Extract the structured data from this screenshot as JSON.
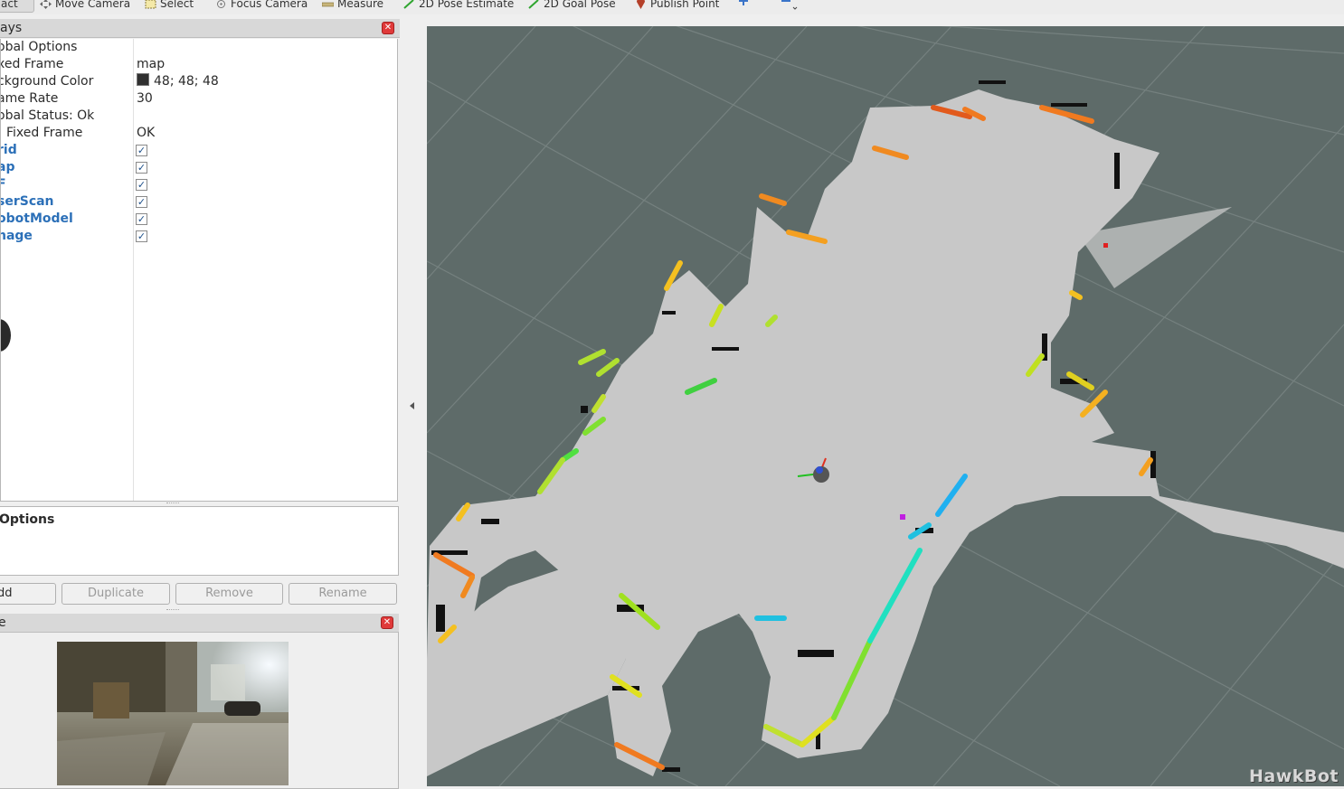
{
  "toolbar": {
    "items": [
      {
        "label": "act",
        "icon": "interact-icon"
      },
      {
        "label": "Move Camera",
        "icon": "move-camera-icon"
      },
      {
        "label": "Select",
        "icon": "select-icon"
      },
      {
        "label": "Focus Camera",
        "icon": "focus-camera-icon"
      },
      {
        "label": "Measure",
        "icon": "measure-icon"
      },
      {
        "label": "2D Pose Estimate",
        "icon": "pose-estimate-icon"
      },
      {
        "label": "2D Goal Pose",
        "icon": "goal-pose-icon"
      },
      {
        "label": "Publish Point",
        "icon": "publish-point-icon"
      }
    ],
    "extra_icons": [
      "plus-icon",
      "minus-icon"
    ]
  },
  "displays_panel": {
    "title": "ays",
    "rows": [
      {
        "name": "obal Options",
        "value": ""
      },
      {
        "name": "xed Frame",
        "value": "map"
      },
      {
        "name": "ckground Color",
        "value": "48; 48; 48",
        "swatch": "#303030"
      },
      {
        "name": "ame Rate",
        "value": "30"
      },
      {
        "name": "obal Status: Ok",
        "value": ""
      },
      {
        "name": "Fixed Frame",
        "value": "OK"
      }
    ],
    "displays": [
      {
        "name": "rid",
        "checked": true
      },
      {
        "name": "ap",
        "checked": true
      },
      {
        "name": "F",
        "checked": true
      },
      {
        "name": "serScan",
        "checked": true
      },
      {
        "name": "obotModel",
        "checked": true
      },
      {
        "name": "nage",
        "checked": true
      }
    ]
  },
  "options_panel": {
    "title": "Options"
  },
  "buttons": {
    "add": "dd",
    "duplicate": "Duplicate",
    "remove": "Remove",
    "rename": "Rename"
  },
  "image_panel": {
    "title": "e"
  },
  "view": {
    "background": "#5e6b69",
    "watermark": "HawkBot"
  }
}
